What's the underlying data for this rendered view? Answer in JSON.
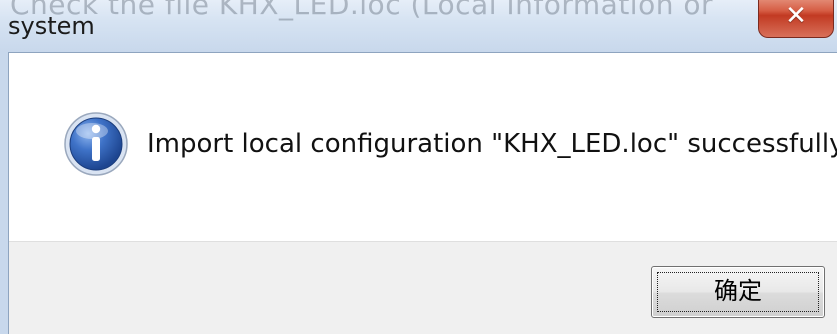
{
  "window": {
    "title": "system",
    "background_overlap_text": "Check the file KHX_LED.loc (Local Information or"
  },
  "message": {
    "text": "Import local configuration \"KHX_LED.loc\" successfully!",
    "icon": "info-icon"
  },
  "buttons": {
    "ok_label": "确定",
    "close_icon": "close-icon"
  },
  "colors": {
    "close_button": "#c23a22",
    "info_icon": "#2f5fb0",
    "titlebar": "#d6e3f2"
  }
}
